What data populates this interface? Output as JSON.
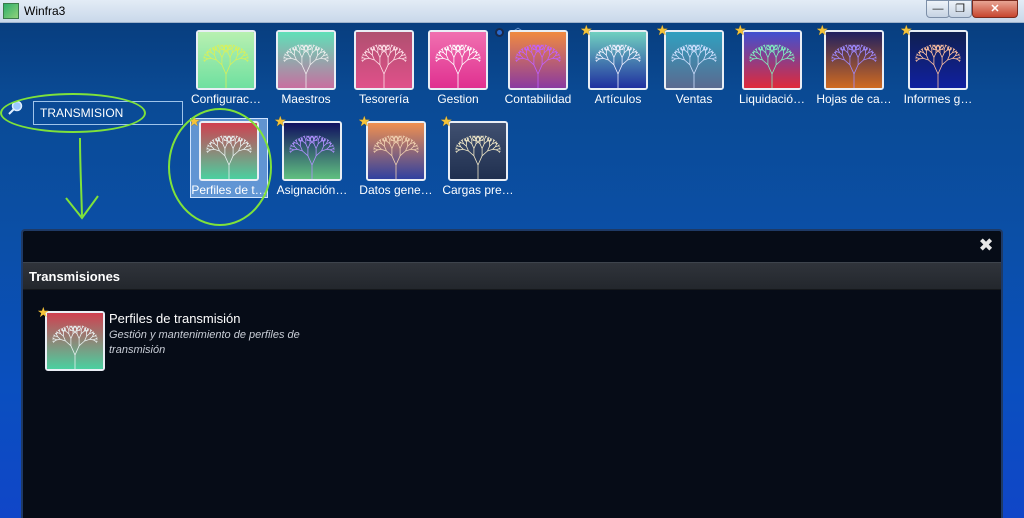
{
  "window": {
    "title": "Winfra3",
    "min_glyph": "—",
    "max_glyph": "❐",
    "close_glyph": "✕"
  },
  "search": {
    "value": "TRANSMISION",
    "icon": "magnifier-icon"
  },
  "colors": {
    "accent_highlight": "#7fe23a",
    "star": "#f5c33a"
  },
  "tiles_row1": [
    {
      "label": "Configurac…",
      "starred": false,
      "grad": [
        "#6fe0a0",
        "#b8f0b0"
      ],
      "tree": "#d9f05a"
    },
    {
      "label": "Maestros",
      "starred": false,
      "grad": [
        "#c86fa0",
        "#5fe0b8"
      ],
      "tree": "#eeeeee"
    },
    {
      "label": "Tesorería",
      "starred": false,
      "grad": [
        "#e0508a",
        "#b05070"
      ],
      "tree": "#ffe0e8"
    },
    {
      "label": "Gestion",
      "starred": false,
      "grad": [
        "#e03090",
        "#f070b0"
      ],
      "tree": "#ffffff"
    },
    {
      "label": "Contabilidad",
      "starred": false,
      "grad": [
        "#8a3aa0",
        "#f08a40"
      ],
      "tree": "#c060ff"
    },
    {
      "label": "Artículos",
      "starred": true,
      "grad": [
        "#2030a0",
        "#70d0c0"
      ],
      "tree": "#f0f0ff"
    },
    {
      "label": "Ventas",
      "starred": true,
      "grad": [
        "#5a6a90",
        "#30a0c0"
      ],
      "tree": "#d0e0ff"
    },
    {
      "label": "Liquidació…",
      "starred": true,
      "grad": [
        "#e02a3a",
        "#4050d0"
      ],
      "tree": "#80f0c0"
    },
    {
      "label": "Hojas de ca…",
      "starred": true,
      "grad": [
        "#d06a20",
        "#202060"
      ],
      "tree": "#9f8aff"
    },
    {
      "label": "Informes g…",
      "starred": true,
      "grad": [
        "#1020a0",
        "#102050"
      ],
      "tree": "#ffc0a0"
    }
  ],
  "tiles_row2": [
    {
      "label": "Perfiles de t…",
      "starred": true,
      "selected": true,
      "grad": [
        "#4ad0a0",
        "#d04050"
      ],
      "tree": "#e8f0f0"
    },
    {
      "label": "Asignación…",
      "starred": true,
      "selected": false,
      "grad": [
        "#60c080",
        "#101060"
      ],
      "tree": "#b090ff"
    },
    {
      "label": "Datos gene…",
      "starred": true,
      "selected": false,
      "grad": [
        "#3040a0",
        "#f09050"
      ],
      "tree": "#f0d0b0"
    },
    {
      "label": "Cargas pre…",
      "starred": true,
      "selected": false,
      "grad": [
        "#203050",
        "#405070"
      ],
      "tree": "#f0e8c8"
    }
  ],
  "results_panel": {
    "close_glyph": "✖",
    "section_title": "Transmisiones",
    "items": [
      {
        "title": "Perfiles de transmisión",
        "description": "Gestión y mantenimiento de perfiles de transmisión",
        "starred": true,
        "grad": [
          "#4ad0a0",
          "#d04050"
        ],
        "tree": "#e8f0f0"
      }
    ]
  }
}
